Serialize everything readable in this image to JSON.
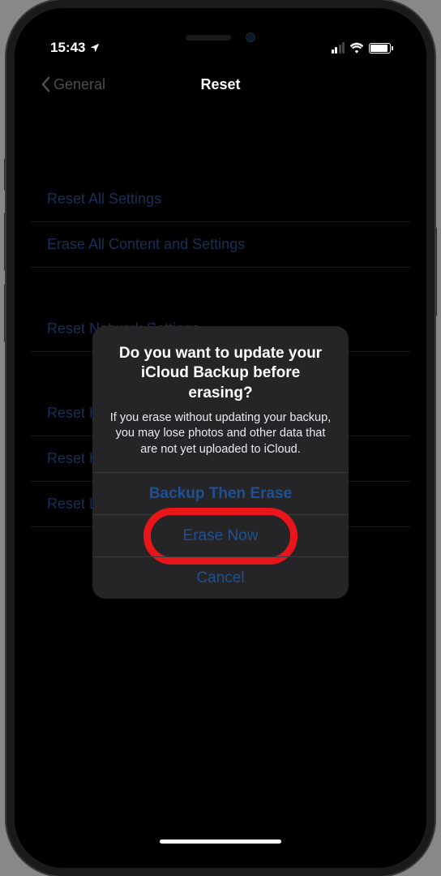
{
  "statusBar": {
    "time": "15:43",
    "locationIcon": "location-arrow"
  },
  "navBar": {
    "backLabel": "General",
    "title": "Reset"
  },
  "groups": [
    {
      "items": [
        {
          "label": "Reset All Settings"
        },
        {
          "label": "Erase All Content and Settings"
        }
      ]
    },
    {
      "items": [
        {
          "label": "Reset Network Settings"
        }
      ]
    },
    {
      "items": [
        {
          "label": "Reset Keyboard Dictionary"
        },
        {
          "label": "Reset Home Screen Layout"
        },
        {
          "label": "Reset Location & Privacy"
        }
      ]
    }
  ],
  "alert": {
    "title": "Do you want to update your iCloud Backup before erasing?",
    "message": "If you erase without updating your backup, you may lose photos and other data that are not yet uploaded to iCloud.",
    "buttons": [
      {
        "label": "Backup Then Erase",
        "bold": true,
        "highlighted": false
      },
      {
        "label": "Erase Now",
        "bold": false,
        "highlighted": true
      },
      {
        "label": "Cancel",
        "bold": false,
        "highlighted": false
      }
    ]
  }
}
